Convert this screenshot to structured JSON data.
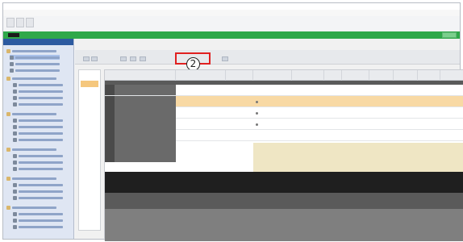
{
  "window": {
    "title": ""
  },
  "menubar": {
    "items": [
      "",
      "",
      "",
      ""
    ]
  },
  "app": {
    "name": "",
    "status": ""
  },
  "sidebar": {
    "header": ""
  },
  "main": {
    "title": ""
  },
  "callout": {
    "label": "2"
  },
  "ribbon": {
    "highlighted_group": [
      "",
      ""
    ]
  },
  "grid": {
    "columns": [
      "",
      "",
      "",
      "",
      "",
      "",
      "",
      "",
      "",
      "",
      ""
    ],
    "rows": [
      [
        "",
        "",
        "",
        "",
        "",
        "",
        "",
        "",
        ""
      ],
      [
        "",
        "",
        "",
        "",
        "",
        "",
        "",
        "",
        ""
      ],
      [
        "",
        "",
        "",
        "",
        "",
        "",
        "",
        "",
        ""
      ],
      [
        "",
        "",
        "",
        "",
        "",
        "",
        "",
        "",
        ""
      ],
      [
        "",
        "",
        "",
        "",
        "",
        "",
        "",
        "",
        ""
      ]
    ]
  },
  "colors": {
    "accent_green": "#2fa84a",
    "highlight_row": "#f8d9a4",
    "callout_box": "#e02020"
  }
}
